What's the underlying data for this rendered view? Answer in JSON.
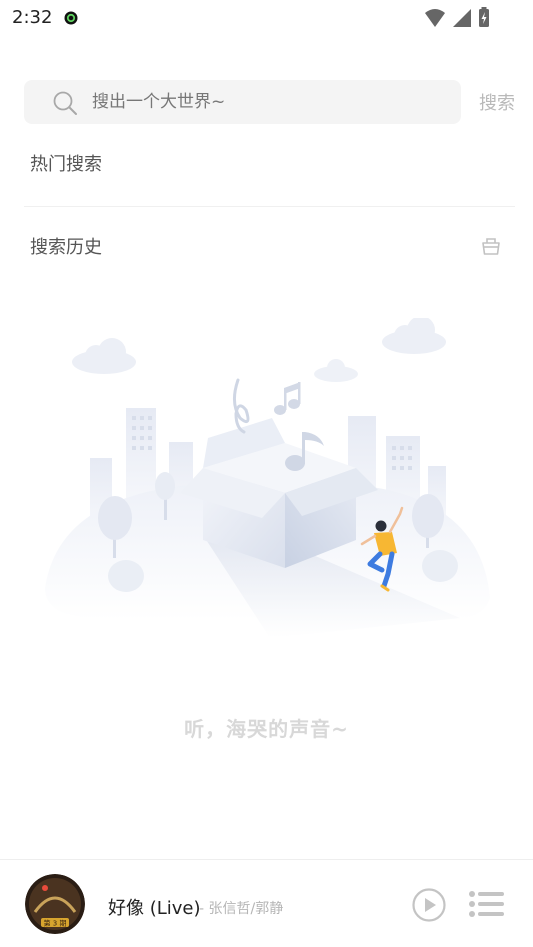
{
  "status_bar": {
    "time": "2:32"
  },
  "search": {
    "placeholder": "搜出一个大世界~",
    "value": "",
    "button_label": "搜索"
  },
  "sections": {
    "hot_search_title": "热门搜索",
    "history_title": "搜索历史"
  },
  "empty_state": {
    "text": "听，海哭的声音~"
  },
  "player": {
    "song_title": "好像 (Live)",
    "artist": "- 张信哲/郭静",
    "cover_badge": "第 3 期"
  },
  "icons": {
    "search": "search-icon",
    "clear_history": "trash-basket-icon",
    "play": "play-circle-icon",
    "playlist": "playlist-icon",
    "wifi": "wifi-icon",
    "signal": "signal-icon",
    "battery": "battery-charging-icon"
  },
  "colors": {
    "accent_gray": "#b9b9b9",
    "search_bg": "#f4f4f4",
    "empty_text": "#d8d8d8"
  }
}
